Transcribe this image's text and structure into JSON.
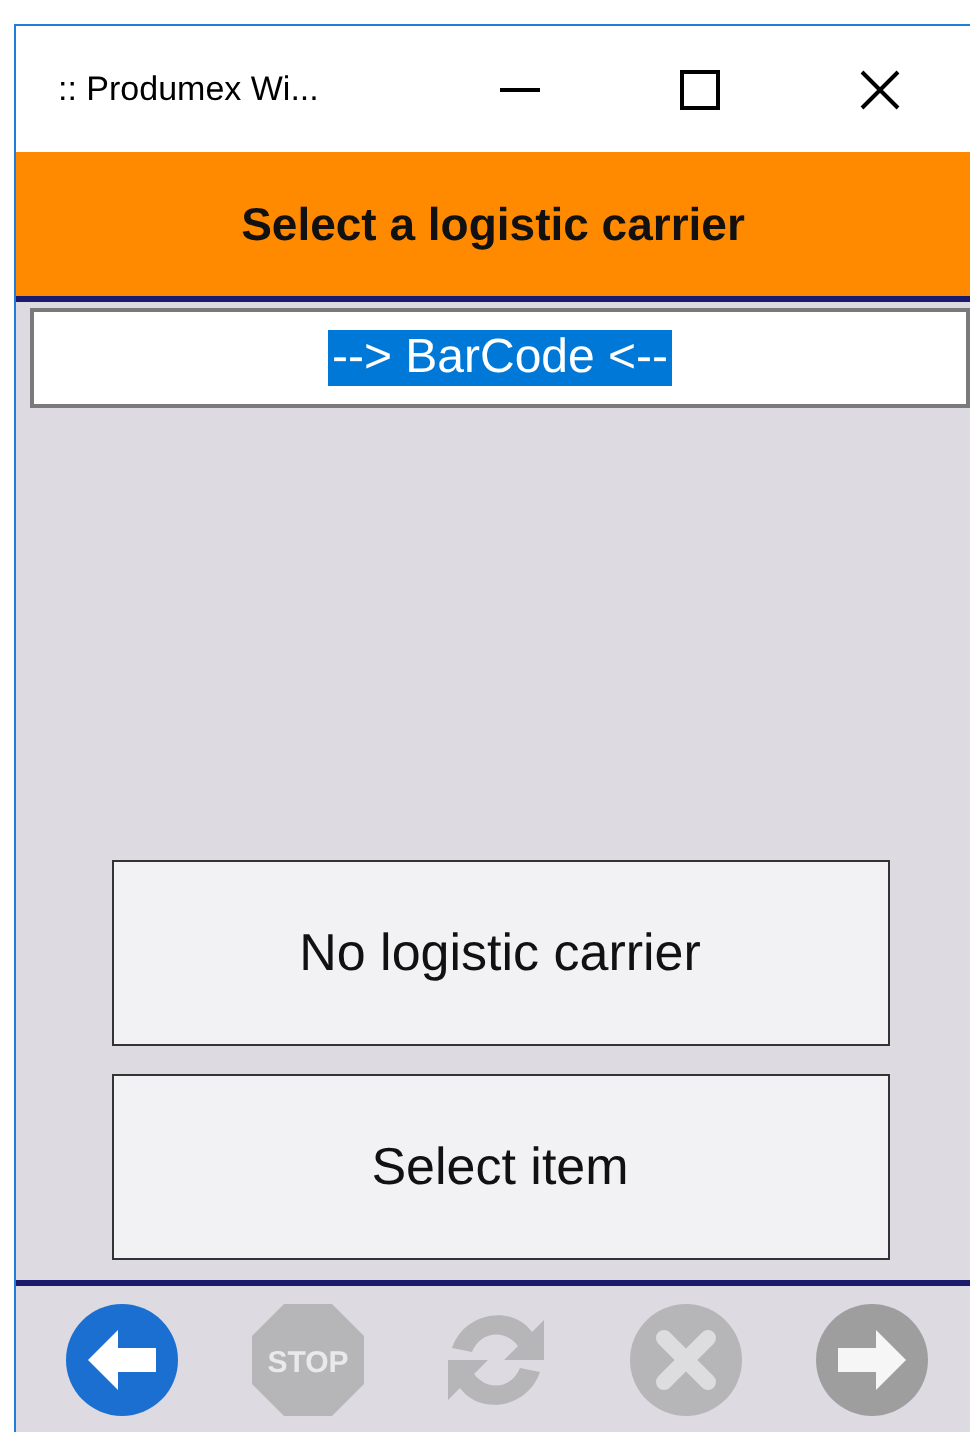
{
  "window": {
    "title": ":: Produmex Wi...",
    "controls": [
      {
        "kind": "minimize"
      },
      {
        "kind": "maximize"
      },
      {
        "kind": "close"
      }
    ]
  },
  "header": {
    "title": "Select a logistic carrier"
  },
  "barcode_field": {
    "value": "--> BarCode <--",
    "text_selected": true
  },
  "buttons": [
    "No logistic carrier",
    "Select item"
  ],
  "toolbar": [
    {
      "kind": "back",
      "disabled": false
    },
    {
      "kind": "stop",
      "label": "STOP",
      "disabled": true
    },
    {
      "kind": "refresh",
      "disabled": true
    },
    {
      "kind": "cancel",
      "disabled": true
    },
    {
      "kind": "forward",
      "disabled": true
    }
  ]
}
